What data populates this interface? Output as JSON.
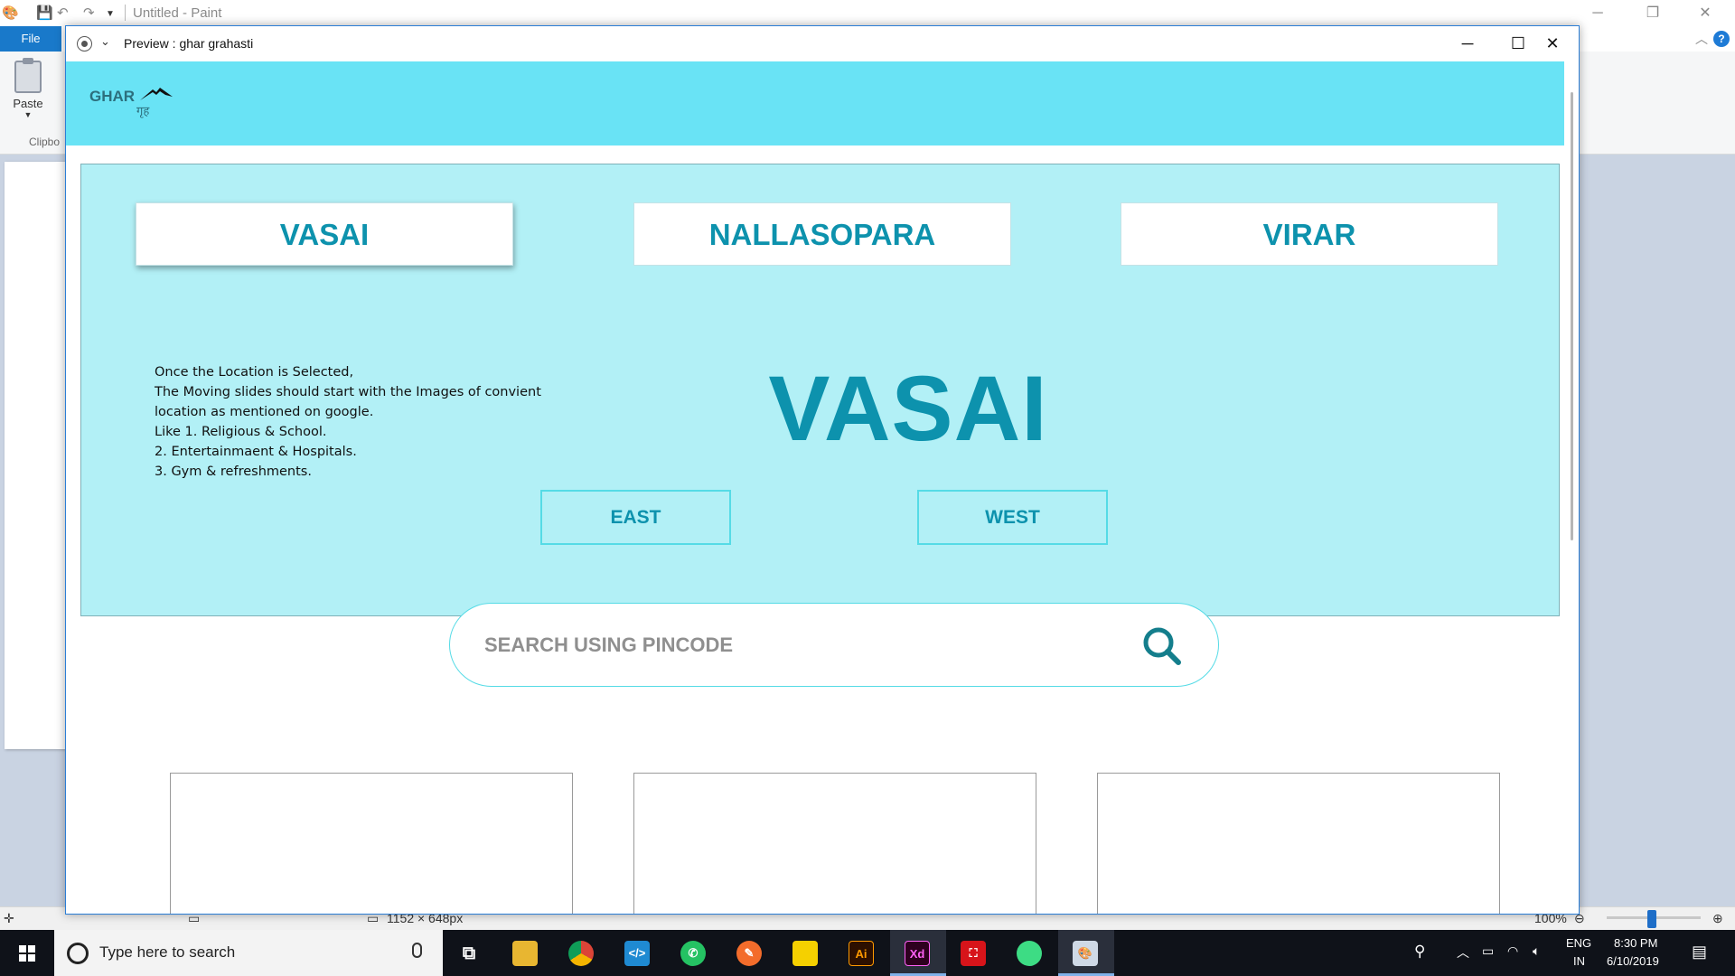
{
  "paint": {
    "title": "Untitled - Paint",
    "file_tab": "File",
    "paste_label": "Paste",
    "clipboard_group": "Clipbo",
    "canvas_size": "1152 × 648px",
    "zoom": "100%"
  },
  "preview": {
    "title": "Preview : ghar grahasti",
    "minimize": "─",
    "maximize": "☐",
    "close": "✕"
  },
  "app": {
    "logo_text": "GHAR",
    "logo_hindi": "गृह",
    "locations": [
      "VASAI",
      "NALLASOPARA",
      "VIRAR"
    ],
    "selected_location": "VASAI",
    "instructions": [
      "Once the Location is Selected,",
      "The Moving slides should start with the Images of convient",
      "location as mentioned on google.",
      "Like 1. Religious & School.",
      "2. Entertainmaent & Hospitals.",
      "3. Gym & refreshments."
    ],
    "directions": [
      "EAST",
      "WEST"
    ],
    "search_placeholder": "SEARCH USING PINCODE"
  },
  "taskbar": {
    "search_placeholder": "Type here to search",
    "apps": [
      "task-view",
      "file-explorer",
      "chrome",
      "vscode",
      "whatsapp",
      "app-orange",
      "sticky-notes",
      "illustrator",
      "xd",
      "acrobat",
      "android-studio",
      "paint"
    ],
    "illustrator_label": "Ai",
    "xd_label": "Xd",
    "language": "ENG",
    "region": "IN",
    "time": "8:30 PM",
    "date": "6/10/2019"
  },
  "colors": {
    "header": "#69e3f5",
    "panel": "#b2f0f6",
    "accent": "#0d92ad",
    "taskbar": "#0f1219"
  }
}
